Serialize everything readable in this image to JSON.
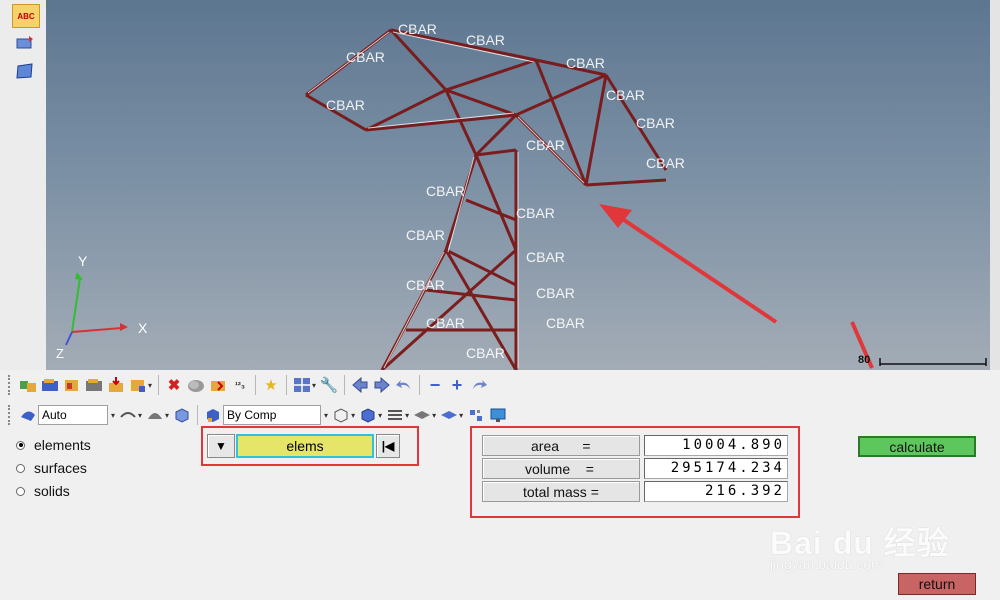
{
  "viewport": {
    "axis": {
      "y": "Y",
      "x": "X",
      "z": "Z"
    },
    "element_labels": [
      "CBAR",
      "CBAR",
      "CBAR",
      "CBAR",
      "CBAR",
      "CBAR",
      "CBAR",
      "CBAR",
      "CBAR",
      "CBAR",
      "CBAR",
      "CBAR",
      "CBAR",
      "CBAR",
      "CBAR",
      "CBAR",
      "CBAR",
      "CBAR"
    ],
    "scale_text": "80"
  },
  "toolbar1": {
    "icons": [
      "display-elements-icon",
      "display-components-icon",
      "display-loadcols-icon",
      "display-systems-icon",
      "display-load-icon",
      "display-elements-by-icon",
      "delete-icon",
      "hide-icon",
      "isolate-icon",
      "renumber-icon",
      "favorite-icon",
      "grid-view-icon",
      "wrench-icon",
      "arrow-left-icon",
      "arrow-right-icon",
      "undo-icon",
      "minus-icon",
      "plus-icon",
      "redo-icon"
    ]
  },
  "toolbar2": {
    "shading_value": "Auto",
    "color_by_value": "By Comp"
  },
  "entity_options": [
    {
      "label": "elements",
      "selected": true
    },
    {
      "label": "surfaces",
      "selected": false
    },
    {
      "label": "solids",
      "selected": false
    }
  ],
  "selector": {
    "label": "elems"
  },
  "results": [
    {
      "label": "area      =",
      "value": "10004.890"
    },
    {
      "label": "volume    =",
      "value": "295174.234"
    },
    {
      "label": "total mass =",
      "value": "216.392"
    }
  ],
  "buttons": {
    "calculate": "calculate",
    "return": "return"
  },
  "watermark": {
    "logo": "Bai du 经验",
    "url": "jingyan.baidu.com"
  },
  "colors": {
    "annotation_red": "#e0383a",
    "calculate_green": "#5dc65d",
    "selector_yellow": "#e5e56a",
    "return_red": "#c86464",
    "frame_red": "#8b1a1a"
  }
}
